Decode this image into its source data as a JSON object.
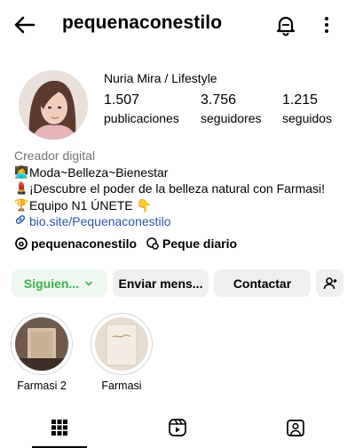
{
  "header": {
    "username": "pequenaconestilo"
  },
  "profile": {
    "display_name": "Nuria Mira / Lifestyle",
    "stats": [
      {
        "value": "1.507",
        "label": "publicaciones"
      },
      {
        "value": "3.756",
        "label": "seguidores"
      },
      {
        "value": "1.215",
        "label": "seguidos"
      }
    ]
  },
  "bio": {
    "category": "Creador digital",
    "lines": [
      {
        "emoji": "👩‍💻",
        "text": "Moda~Belleza~Bienestar"
      },
      {
        "emoji": "💄",
        "text": "¡Descubre el poder de la belleza natural con Farmasi!"
      },
      {
        "emoji": "🏆",
        "text": "Equipo N1 ÚNETE 👇"
      }
    ],
    "link": "bio.site/Pequenaconestilo"
  },
  "socials": {
    "threads": "pequenaconestilo",
    "channel": "Peque diario"
  },
  "buttons": {
    "follow": "Siguien...",
    "message": "Enviar mens...",
    "contact": "Contactar"
  },
  "highlights": [
    {
      "label": "Farmasi 2"
    },
    {
      "label": "Farmasi"
    }
  ],
  "colors": {
    "accent_green": "#3bb04a",
    "link_blue": "#2a56a8",
    "button_bg": "#efefef"
  }
}
